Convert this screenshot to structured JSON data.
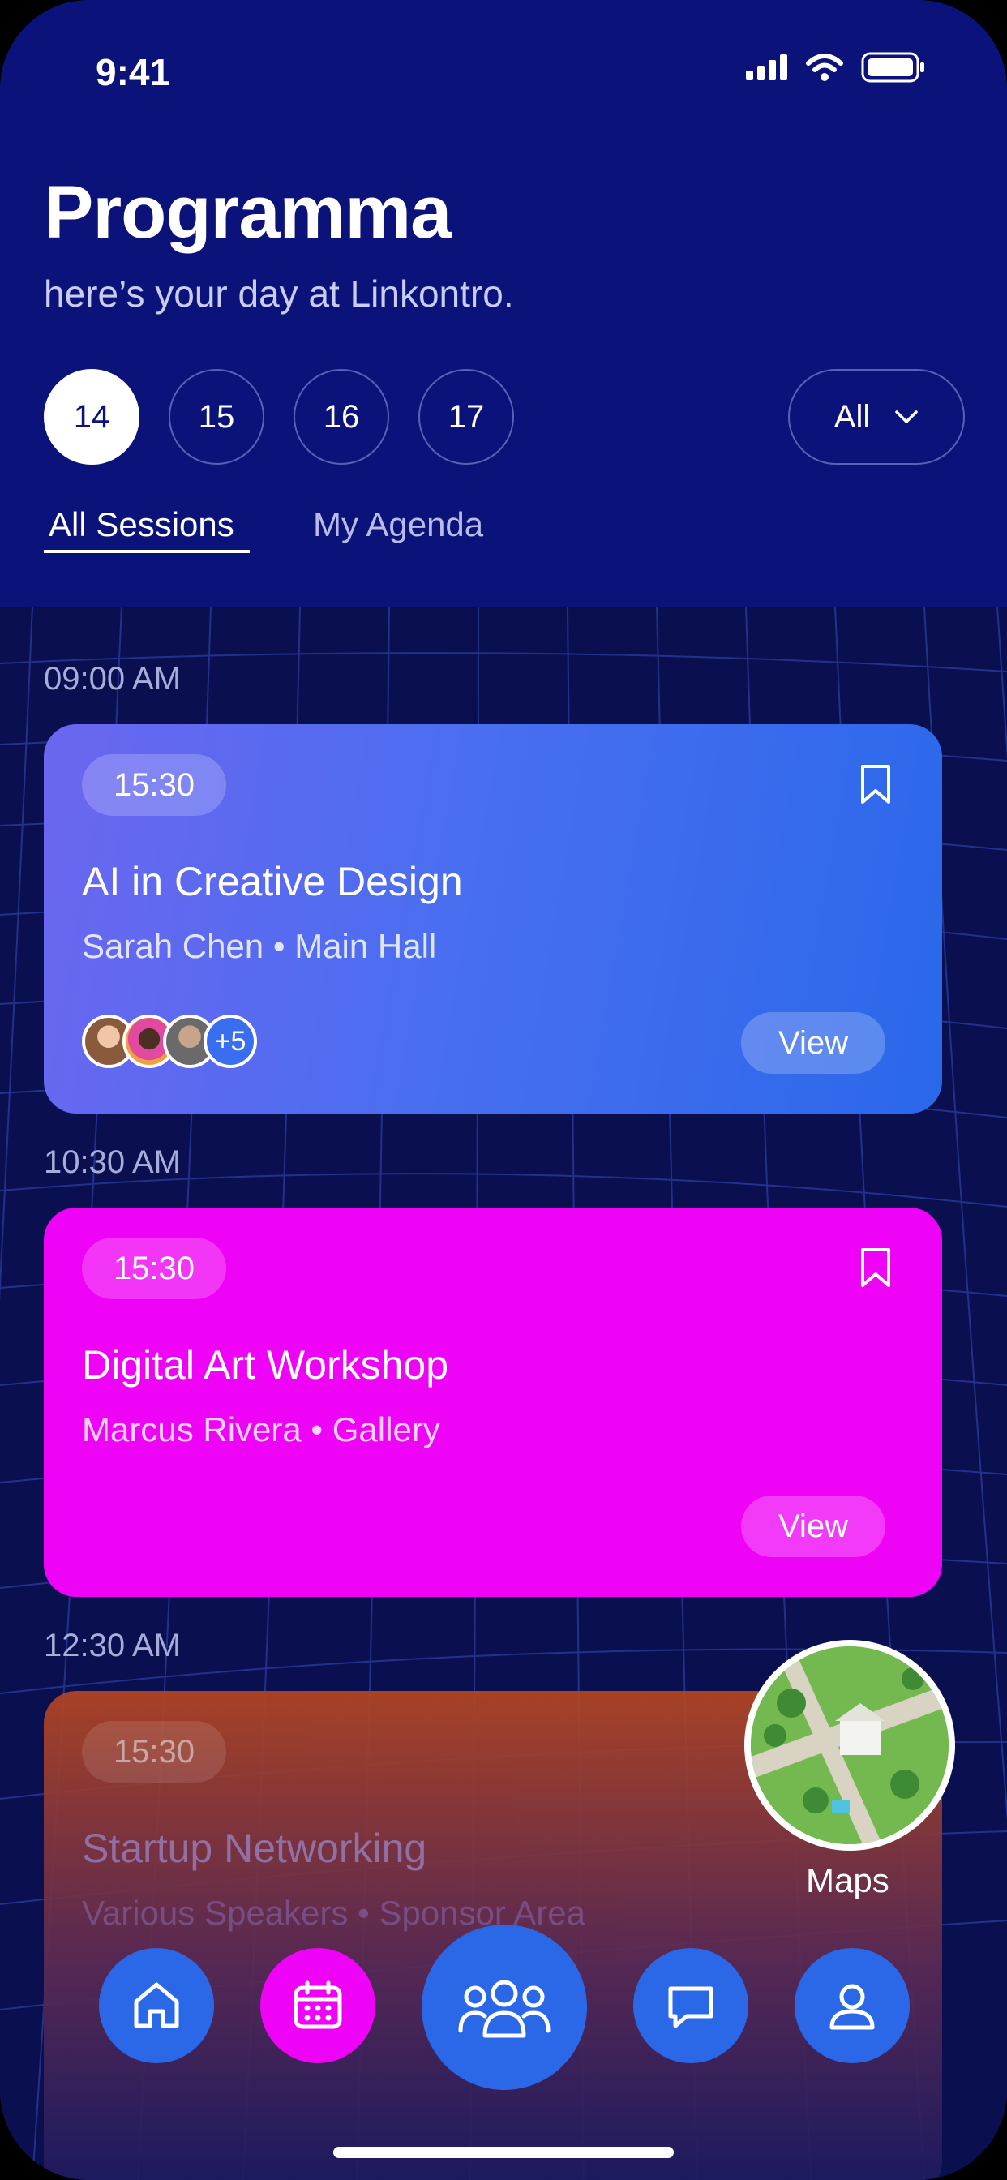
{
  "status_bar": {
    "time": "9:41"
  },
  "header": {
    "title": "Programma",
    "subtitle": "here’s your day at Linkontro."
  },
  "days": [
    "14",
    "15",
    "16",
    "17"
  ],
  "selected_day": "14",
  "filter": {
    "label": "All"
  },
  "tabs": [
    {
      "label": "All Sessions",
      "active": true
    },
    {
      "label": "My Agenda",
      "active": false
    }
  ],
  "sessions": [
    {
      "time_label": "09:00 AM",
      "pill_time": "15:30",
      "title": "AI in Creative Design",
      "subtitle": "Sarah Chen • Main Hall",
      "attendees_more": "+5",
      "view_label": "View",
      "color": "#4a6ef0"
    },
    {
      "time_label": "10:30 AM",
      "pill_time": "15:30",
      "title": "Digital Art Workshop",
      "subtitle": "Marcus Rivera • Gallery",
      "view_label": "View",
      "color": "#ef03f6"
    },
    {
      "time_label": "12:30 AM",
      "pill_time": "15:30",
      "title": "Startup Networking",
      "subtitle": "Various Speakers • Sponsor Area",
      "color": "#b54622"
    }
  ],
  "maps": {
    "label": "Maps"
  },
  "bottom_nav": [
    {
      "icon": "home-icon"
    },
    {
      "icon": "calendar-icon",
      "active": true
    },
    {
      "icon": "people-icon"
    },
    {
      "icon": "chat-icon"
    },
    {
      "icon": "profile-icon"
    }
  ],
  "colors": {
    "header_bg": "#0b137a",
    "accent_blue": "#2b68e8",
    "accent_pink": "#ef03f6"
  }
}
